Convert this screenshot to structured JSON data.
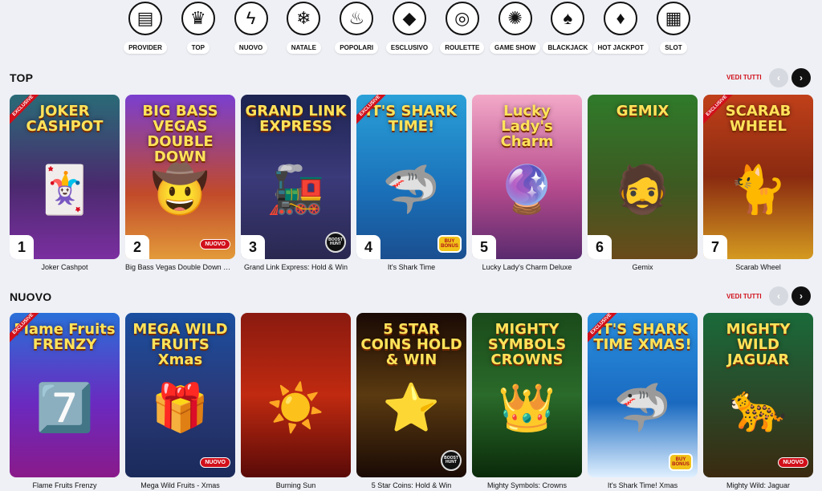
{
  "categories": [
    {
      "label": "PROVIDER",
      "icon": "book-icon",
      "glyph": "▤"
    },
    {
      "label": "TOP",
      "icon": "crown-icon",
      "glyph": "♛"
    },
    {
      "label": "NUOVO",
      "icon": "lightning-icon",
      "glyph": "ϟ"
    },
    {
      "label": "NATALE",
      "icon": "ornament-icon",
      "glyph": "❄"
    },
    {
      "label": "POPOLARI",
      "icon": "flame-icon",
      "glyph": "♨"
    },
    {
      "label": "ESCLUSIVO",
      "icon": "diamond-icon",
      "glyph": "◆"
    },
    {
      "label": "ROULETTE",
      "icon": "roulette-icon",
      "glyph": "◎"
    },
    {
      "label": "GAME SHOW",
      "icon": "wheel-icon",
      "glyph": "✺"
    },
    {
      "label": "BLACKJACK",
      "icon": "spade-icon",
      "glyph": "♠"
    },
    {
      "label": "HOT JACKPOT",
      "icon": "chili-icon",
      "glyph": "♦"
    },
    {
      "label": "SLOT",
      "icon": "slot-machine-icon",
      "glyph": "▦"
    }
  ],
  "sections": {
    "top": {
      "title": "TOP",
      "see_all": "VEDI TUTTI",
      "games": [
        {
          "name": "Joker Cashpot",
          "art_title": "JOKER CASHPOT",
          "rank": "1",
          "bg": "linear-gradient(180deg,#2a6b77 0%,#4a2a6e 55%,#7b2fa0 100%)",
          "art": "🃏",
          "exclusive": true,
          "nuovo": false,
          "badge": ""
        },
        {
          "name": "Big Bass Vegas Double Down Deluxe",
          "art_title": "BIG BASS VEGAS DOUBLE DOWN",
          "rank": "2",
          "bg": "linear-gradient(180deg,#7a3fd0 0%,#c14a2a 60%,#e39a3a 100%)",
          "art": "🤠",
          "exclusive": false,
          "nuovo": true,
          "badge": ""
        },
        {
          "name": "Grand Link Express: Hold & Win",
          "art_title": "GRAND LINK EXPRESS",
          "rank": "3",
          "bg": "linear-gradient(180deg,#1d2450 0%,#3b3a7a 50%,#2a2850 100%)",
          "art": "🚂",
          "exclusive": false,
          "nuovo": false,
          "badge": "BOOST HUNT"
        },
        {
          "name": "It's Shark Time",
          "art_title": "IT'S SHARK TIME!",
          "rank": "4",
          "bg": "linear-gradient(180deg,#2aa0d8 0%,#1a6fb8 60%,#1a4f90 100%)",
          "art": "🦈",
          "exclusive": true,
          "nuovo": false,
          "badge": "BUY BONUS"
        },
        {
          "name": "Lucky Lady's Charm Deluxe",
          "art_title": "Lucky Lady's Charm",
          "rank": "5",
          "bg": "linear-gradient(180deg,#f3a9c8 0%,#b84c8e 55%,#5a2a6e 100%)",
          "art": "🔮",
          "exclusive": false,
          "nuovo": false,
          "badge": ""
        },
        {
          "name": "Gemix",
          "art_title": "GEMIX",
          "rank": "6",
          "bg": "linear-gradient(180deg,#2f7a2a 0%,#3d5a22 55%,#6a4a1a 100%)",
          "art": "🧔",
          "exclusive": false,
          "nuovo": false,
          "badge": ""
        },
        {
          "name": "Scarab Wheel",
          "art_title": "SCARAB WHEEL",
          "rank": "7",
          "bg": "linear-gradient(180deg,#c0401a 0%,#8a2a10 50%,#d49a20 100%)",
          "art": "🐈",
          "exclusive": true,
          "nuovo": false,
          "badge": ""
        }
      ]
    },
    "nuovo": {
      "title": "NUOVO",
      "see_all": "VEDI TUTTI",
      "games": [
        {
          "name": "Flame Fruits Frenzy",
          "art_title": "Flame Fruits FRENZY",
          "rank": "",
          "bg": "linear-gradient(180deg,#2a70d8 0%,#6a2ac0 55%,#8a1a8a 100%)",
          "art": "7️⃣",
          "exclusive": true,
          "nuovo": false,
          "badge": ""
        },
        {
          "name": "Mega Wild Fruits - Xmas",
          "art_title": "MEGA WILD FRUITS Xmas",
          "rank": "",
          "bg": "linear-gradient(180deg,#1a4fa0 0%,#2a3a7a 50%,#1a2a5a 100%)",
          "art": "🎁",
          "exclusive": false,
          "nuovo": true,
          "badge": ""
        },
        {
          "name": "Burning Sun",
          "art_title": "",
          "rank": "",
          "bg": "linear-gradient(180deg,#8a1a10 0%,#c02a10 50%,#5a0a08 100%)",
          "art": "☀️",
          "exclusive": false,
          "nuovo": false,
          "badge": ""
        },
        {
          "name": "5 Star Coins: Hold & Win",
          "art_title": "5 STAR COINS HOLD & WIN",
          "rank": "",
          "bg": "linear-gradient(180deg,#1a0a05 0%,#5a3a10 50%,#1a0a05 100%)",
          "art": "⭐",
          "exclusive": false,
          "nuovo": false,
          "badge": "BOOST HUNT"
        },
        {
          "name": "Mighty Symbols: Crowns",
          "art_title": "MIGHTY SYMBOLS CROWNS",
          "rank": "",
          "bg": "linear-gradient(180deg,#1a4a1a 0%,#2a6a2a 50%,#0a2a0a 100%)",
          "art": "👑",
          "exclusive": false,
          "nuovo": false,
          "badge": ""
        },
        {
          "name": "It's Shark Time! Xmas",
          "art_title": "IT'S SHARK TIME XMAS!",
          "rank": "",
          "bg": "linear-gradient(180deg,#2a90e0 0%,#1a6ac0 55%,#e0f0ff 100%)",
          "art": "🦈",
          "exclusive": true,
          "nuovo": false,
          "badge": "BUY BONUS"
        },
        {
          "name": "Mighty Wild: Jaguar",
          "art_title": "MIGHTY WILD JAGUAR",
          "rank": "",
          "bg": "linear-gradient(180deg,#1a6a3a 0%,#2a4a2a 50%,#3a2a10 100%)",
          "art": "🐆",
          "exclusive": false,
          "nuovo": true,
          "badge": ""
        }
      ]
    }
  },
  "labels": {
    "exclusive": "EXCLUSIVE",
    "nuovo": "NUOVO",
    "prev": "‹",
    "next": "›"
  }
}
